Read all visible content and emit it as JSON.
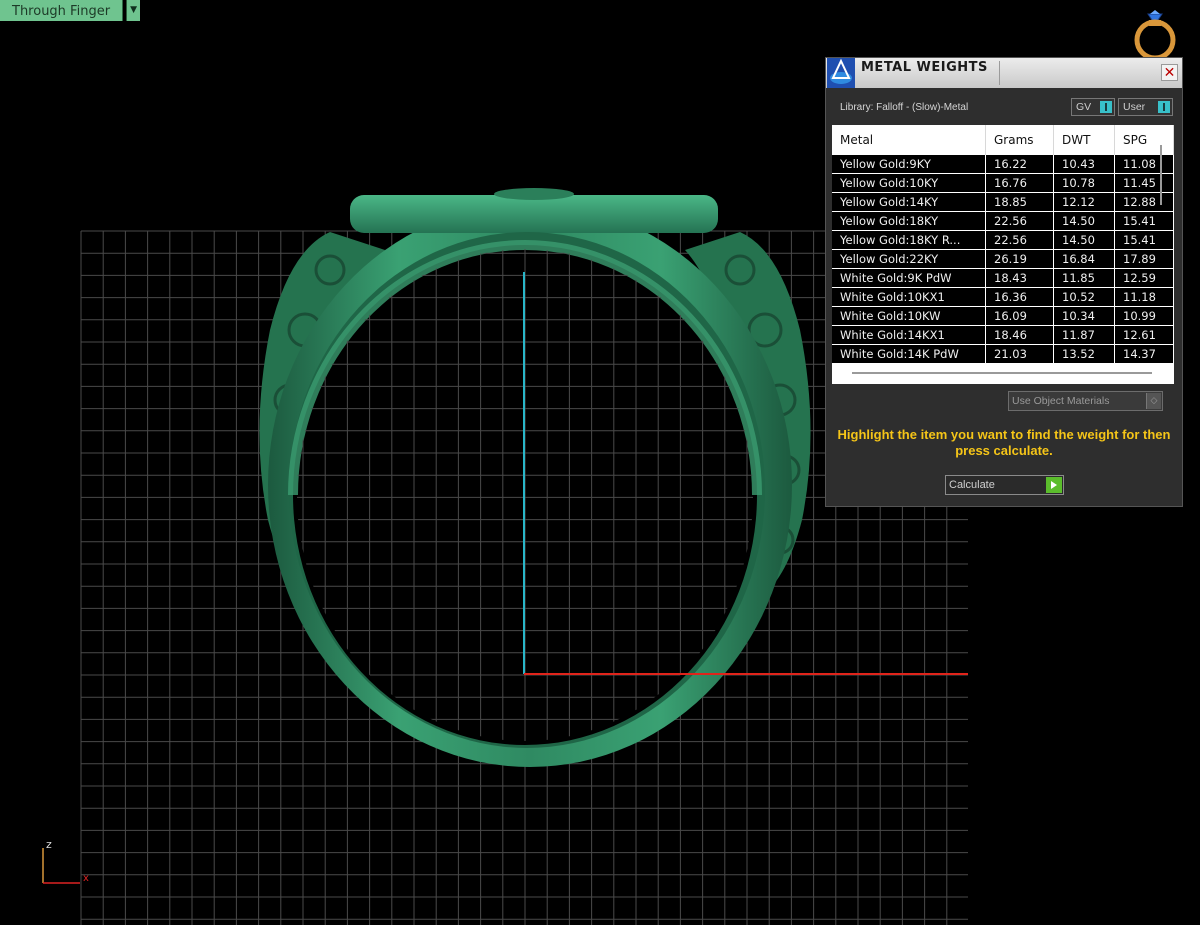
{
  "view": {
    "label": "Through Finger"
  },
  "axis": {
    "z_label": "z",
    "x_label": "x"
  },
  "colors": {
    "ring_green": "#2f8a63",
    "grid_line": "#4a4a4a",
    "axis_vertical": "#29b6c8",
    "axis_horizontal": "#e0241b",
    "panel_bg": "#2e2e2e",
    "instruction_text": "#f5c518",
    "toggle_accent": "#38c0c9",
    "calc_accent": "#5bbd2c"
  },
  "panel": {
    "title": "METAL WEIGHTS",
    "close_icon": "close-icon",
    "library_label": "Library: Falloff - (Slow)-Metal",
    "toggle_gv": "GV",
    "toggle_user": "User",
    "material_select": "Use Object Materials",
    "instruction": "Highlight the item you want to find the weight for then press calculate.",
    "calculate_label": "Calculate"
  },
  "table": {
    "headers": [
      "Metal",
      "Grams",
      "DWT",
      "SPG"
    ],
    "rows": [
      [
        "Yellow Gold:9KY",
        "16.22",
        "10.43",
        "11.08"
      ],
      [
        "Yellow Gold:10KY",
        "16.76",
        "10.78",
        "11.45"
      ],
      [
        "Yellow Gold:14KY",
        "18.85",
        "12.12",
        "12.88"
      ],
      [
        "Yellow Gold:18KY",
        "22.56",
        "14.50",
        "15.41"
      ],
      [
        "Yellow Gold:18KY R...",
        "22.56",
        "14.50",
        "15.41"
      ],
      [
        "Yellow Gold:22KY",
        "26.19",
        "16.84",
        "17.89"
      ],
      [
        "White Gold:9K PdW",
        "18.43",
        "11.85",
        "12.59"
      ],
      [
        "White Gold:10KX1",
        "16.36",
        "10.52",
        "11.18"
      ],
      [
        "White Gold:10KW",
        "16.09",
        "10.34",
        "10.99"
      ],
      [
        "White Gold:14KX1",
        "18.46",
        "11.87",
        "12.61"
      ],
      [
        "White Gold:14K PdW",
        "21.03",
        "13.52",
        "14.37"
      ]
    ]
  }
}
